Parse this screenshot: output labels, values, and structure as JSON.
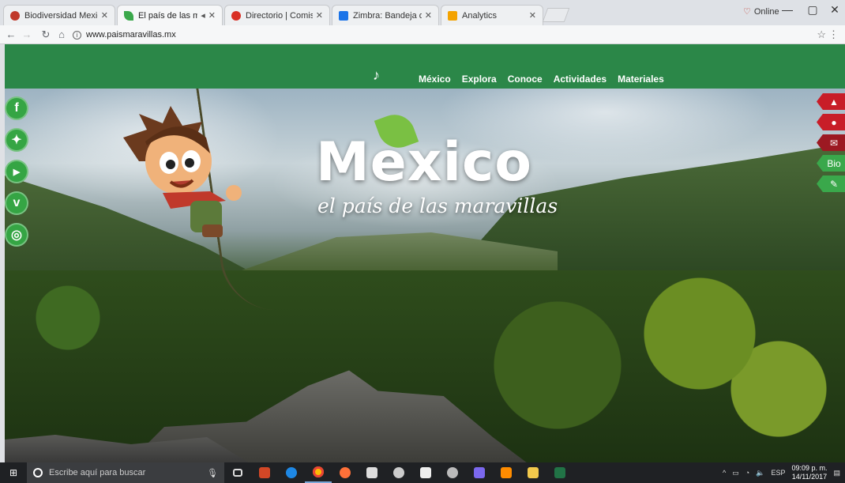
{
  "browser": {
    "tabs": [
      {
        "title": "Biodiversidad Mexicana",
        "icon": "biodiversidad-favicon",
        "color": "#c0392b",
        "active": false
      },
      {
        "title": "El país de las maravill",
        "icon": "leaf-favicon",
        "color": "#3aa84b",
        "active": true
      },
      {
        "title": "Directorio | Comisión N",
        "icon": "red-circle-favicon",
        "color": "#d93025",
        "active": false
      },
      {
        "title": "Zimbra: Bandeja de entr",
        "icon": "zimbra-favicon",
        "color": "#1a73e8",
        "active": false
      },
      {
        "title": "Analytics",
        "icon": "analytics-favicon",
        "color": "#f4a300",
        "active": false
      }
    ],
    "profile_name": "Online",
    "url": "www.paismaravillas.mx"
  },
  "site": {
    "nav": [
      "México",
      "Explora",
      "Conoce",
      "Actividades",
      "Materiales"
    ],
    "hero_title": "Mexico",
    "hero_subtitle": "el país de las maravillas",
    "social": [
      {
        "name": "facebook-icon",
        "glyph": "f"
      },
      {
        "name": "twitter-icon",
        "glyph": "🐦"
      },
      {
        "name": "youtube-icon",
        "glyph": "▶"
      },
      {
        "name": "vimeo-icon",
        "glyph": "v"
      },
      {
        "name": "instagram-icon",
        "glyph": "◎"
      }
    ],
    "right_buttons": [
      {
        "name": "graduation-cap-icon",
        "glyph": "🎓",
        "label": ""
      },
      {
        "name": "globe-icon",
        "glyph": "🌐",
        "label": ""
      },
      {
        "name": "envelope-icon",
        "glyph": "✉",
        "label": ""
      },
      {
        "name": "bio-button",
        "glyph": "",
        "label": "Bio"
      },
      {
        "name": "pencil-icon",
        "glyph": "✎",
        "label": ""
      }
    ]
  },
  "taskbar": {
    "search_placeholder": "Escribe aquí para buscar",
    "language": "ESP",
    "time": "09:09 p. m.",
    "date": "14/11/2017"
  }
}
